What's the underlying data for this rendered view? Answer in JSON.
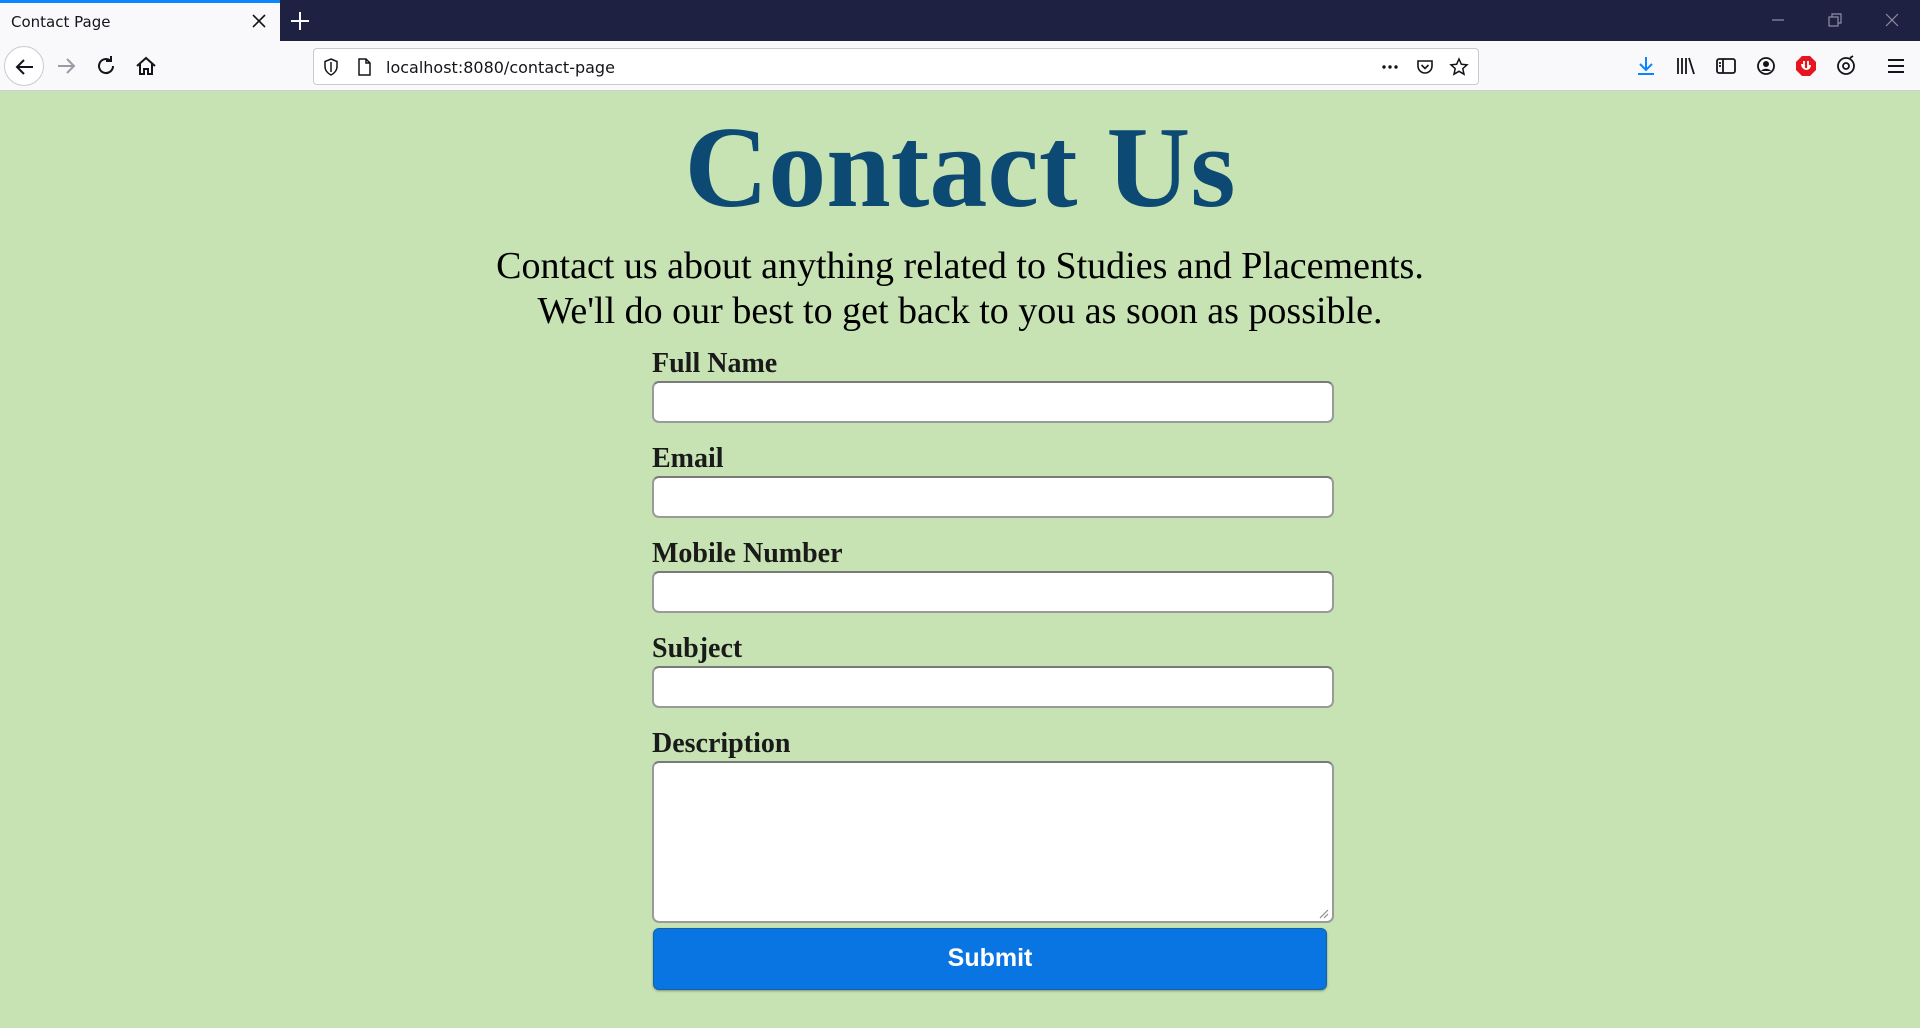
{
  "browser": {
    "tab_title": "Contact Page",
    "url": "localhost:8080/contact-page",
    "accent_color": "#0a84ff",
    "titlebar_color": "#1f2143"
  },
  "page": {
    "title": "Contact Us",
    "intro_line1": "Contact us about anything related to Studies and Placements.",
    "intro_line2": "We'll do our best to get back to you as soon as possible.",
    "background_color": "#c7e2b3",
    "title_color": "#0d4a73"
  },
  "form": {
    "fields": [
      {
        "label": "Full Name",
        "value": ""
      },
      {
        "label": "Email",
        "value": ""
      },
      {
        "label": "Mobile Number",
        "value": ""
      },
      {
        "label": "Subject",
        "value": ""
      },
      {
        "label": "Description",
        "value": ""
      }
    ],
    "submit_label": "Submit",
    "submit_color": "#0875e3"
  },
  "icons": {
    "tab_close": "close-icon",
    "new_tab": "plus-icon",
    "back": "arrow-left-icon",
    "forward": "arrow-right-icon",
    "reload": "reload-icon",
    "home": "home-icon",
    "tracking": "shield-icon",
    "page": "page-icon",
    "more": "more-icon",
    "pocket": "pocket-icon",
    "bookmark": "star-icon",
    "downloads": "download-icon",
    "library": "library-icon",
    "sidebar": "sidebar-icon",
    "account": "account-icon",
    "blocker": "block-icon",
    "sync": "sync-icon",
    "menu": "hamburger-icon"
  }
}
